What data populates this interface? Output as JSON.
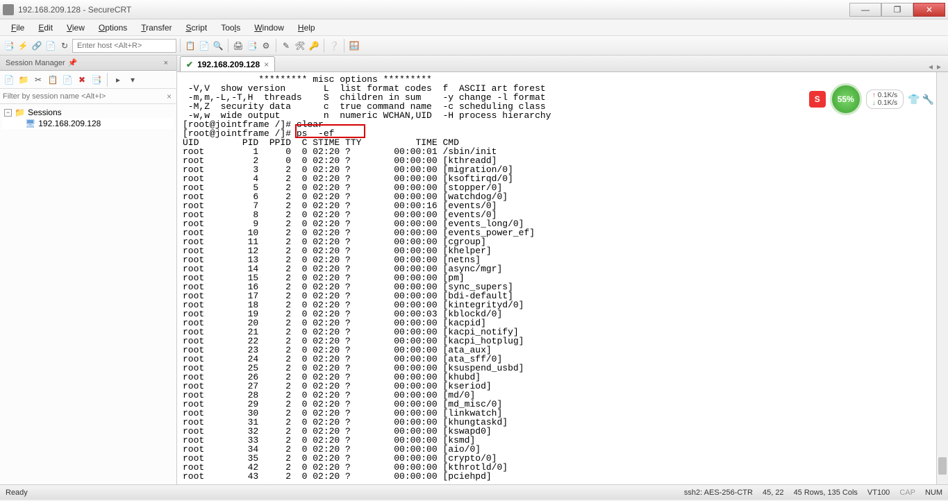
{
  "window": {
    "title": "192.168.209.128 - SecureCRT"
  },
  "menu": {
    "file": "File",
    "edit": "Edit",
    "view": "View",
    "options": "Options",
    "transfer": "Transfer",
    "script": "Script",
    "tools": "Tools",
    "window": "Window",
    "help": "Help"
  },
  "toolbar": {
    "host_placeholder": "Enter host <Alt+R>"
  },
  "session_manager": {
    "title": "Session Manager",
    "filter_placeholder": "Filter by session name <Alt+I>",
    "root": "Sessions",
    "host": "192.168.209.128"
  },
  "tab": {
    "label": "192.168.209.128"
  },
  "terminal": {
    "lines": [
      "              ********* misc options *********",
      " -V,V  show version       L  list format codes  f  ASCII art forest",
      " -m,m,-L,-T,H  threads    S  children in sum    -y change -l format",
      " -M,Z  security data      c  true command name  -c scheduling class",
      " -w,w  wide output        n  numeric WCHAN,UID  -H process hierarchy",
      "[root@jointframe /]# clear",
      "[root@jointframe /]# ps  -ef",
      "UID        PID  PPID  C STIME TTY          TIME CMD",
      "root         1     0  0 02:20 ?        00:00:01 /sbin/init",
      "root         2     0  0 02:20 ?        00:00:00 [kthreadd]",
      "root         3     2  0 02:20 ?        00:00:00 [migration/0]",
      "root         4     2  0 02:20 ?        00:00:00 [ksoftirqd/0]",
      "root         5     2  0 02:20 ?        00:00:00 [stopper/0]",
      "root         6     2  0 02:20 ?        00:00:00 [watchdog/0]",
      "root         7     2  0 02:20 ?        00:00:16 [events/0]",
      "root         8     2  0 02:20 ?        00:00:00 [events/0]",
      "root         9     2  0 02:20 ?        00:00:00 [events_long/0]",
      "root        10     2  0 02:20 ?        00:00:00 [events_power_ef]",
      "root        11     2  0 02:20 ?        00:00:00 [cgroup]",
      "root        12     2  0 02:20 ?        00:00:00 [khelper]",
      "root        13     2  0 02:20 ?        00:00:00 [netns]",
      "root        14     2  0 02:20 ?        00:00:00 [async/mgr]",
      "root        15     2  0 02:20 ?        00:00:00 [pm]",
      "root        16     2  0 02:20 ?        00:00:00 [sync_supers]",
      "root        17     2  0 02:20 ?        00:00:00 [bdi-default]",
      "root        18     2  0 02:20 ?        00:00:00 [kintegrityd/0]",
      "root        19     2  0 02:20 ?        00:00:03 [kblockd/0]",
      "root        20     2  0 02:20 ?        00:00:00 [kacpid]",
      "root        21     2  0 02:20 ?        00:00:00 [kacpi_notify]",
      "root        22     2  0 02:20 ?        00:00:00 [kacpi_hotplug]",
      "root        23     2  0 02:20 ?        00:00:00 [ata_aux]",
      "root        24     2  0 02:20 ?        00:00:00 [ata_sff/0]",
      "root        25     2  0 02:20 ?        00:00:00 [ksuspend_usbd]",
      "root        26     2  0 02:20 ?        00:00:00 [khubd]",
      "root        27     2  0 02:20 ?        00:00:00 [kseriod]",
      "root        28     2  0 02:20 ?        00:00:00 [md/0]",
      "root        29     2  0 02:20 ?        00:00:00 [md_misc/0]",
      "root        30     2  0 02:20 ?        00:00:00 [linkwatch]",
      "root        31     2  0 02:20 ?        00:00:00 [khungtaskd]",
      "root        32     2  0 02:20 ?        00:00:00 [kswapd0]",
      "root        33     2  0 02:20 ?        00:00:00 [ksmd]",
      "root        34     2  0 02:20 ?        00:00:00 [aio/0]",
      "root        35     2  0 02:20 ?        00:00:00 [crypto/0]",
      "root        42     2  0 02:20 ?        00:00:00 [kthrotld/0]",
      "root        43     2  0 02:20 ?        00:00:00 [pciehpd]"
    ],
    "highlight_cmd": "ps  -ef"
  },
  "status": {
    "ready": "Ready",
    "conn": "ssh2: AES-256-CTR",
    "pos": "45,  22",
    "size": "45 Rows, 135 Cols",
    "term": "VT100",
    "cap": "CAP",
    "num": "NUM"
  },
  "overlay": {
    "pct": "55%",
    "up": "0.1K/s",
    "down": "0.1K/s",
    "s": "S"
  }
}
